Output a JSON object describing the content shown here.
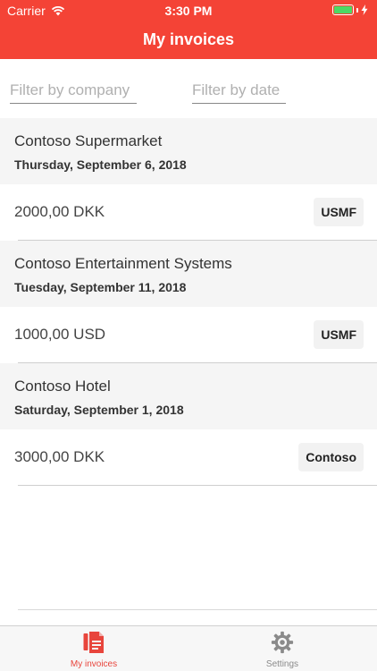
{
  "status_bar": {
    "carrier": "Carrier",
    "time": "3:30 PM"
  },
  "header": {
    "title": "My invoices"
  },
  "filters": {
    "company_placeholder": "Filter by company",
    "date_placeholder": "Filter by date"
  },
  "invoices": [
    {
      "company": "Contoso Supermarket",
      "date": "Thursday, September 6, 2018",
      "amount": "2000,00 DKK",
      "entity": "USMF"
    },
    {
      "company": "Contoso Entertainment Systems",
      "date": "Tuesday, September 11, 2018",
      "amount": "1000,00 USD",
      "entity": "USMF"
    },
    {
      "company": "Contoso Hotel",
      "date": "Saturday, September 1, 2018",
      "amount": "3000,00 DKK",
      "entity": "Contoso"
    }
  ],
  "tabs": [
    {
      "label": "My invoices",
      "icon": "invoice-icon",
      "active": true
    },
    {
      "label": "Settings",
      "icon": "gear-icon",
      "active": false
    }
  ],
  "colors": {
    "accent": "#f44336",
    "active_tab": "#e8453c",
    "battery": "#4cd964"
  }
}
